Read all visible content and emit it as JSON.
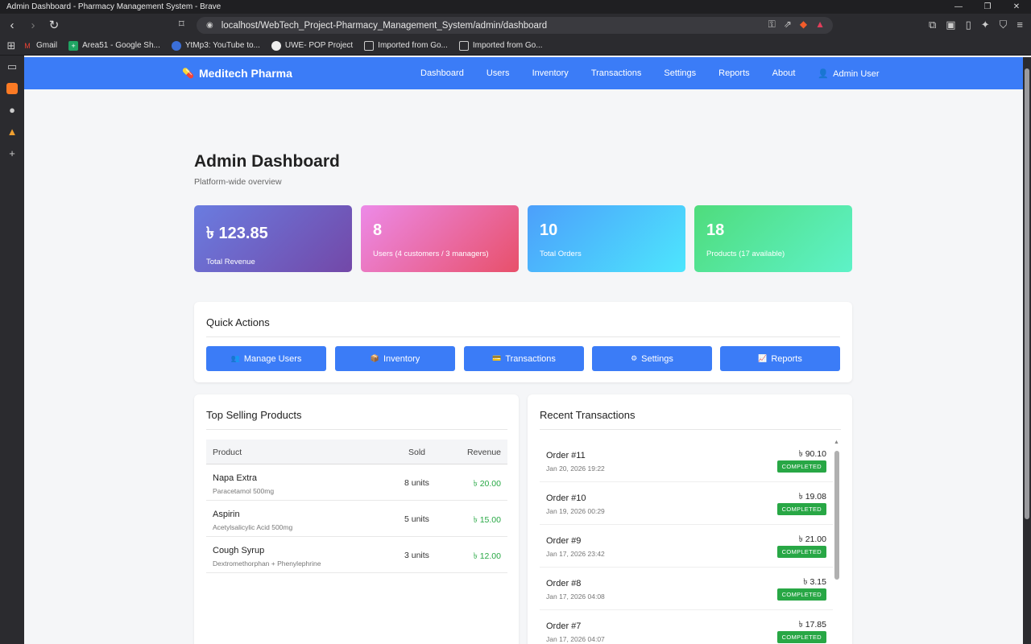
{
  "browser": {
    "window_title": "Admin Dashboard - Pharmacy Management System - Brave",
    "url": "localhost/WebTech_Project-Pharmacy_Management_System/admin/dashboard",
    "bookmarks": [
      {
        "label": "Gmail"
      },
      {
        "label": "Area51 - Google Sh..."
      },
      {
        "label": "YtMp3: YouTube to..."
      },
      {
        "label": "UWE- POP Project"
      },
      {
        "label": "Imported from Go..."
      },
      {
        "label": "Imported from Go..."
      }
    ]
  },
  "app": {
    "brand": "Meditech Pharma",
    "nav": [
      "Dashboard",
      "Users",
      "Inventory",
      "Transactions",
      "Settings",
      "Reports",
      "About"
    ],
    "user": "Admin User",
    "accent": "#3b7cf7"
  },
  "page": {
    "title": "Admin Dashboard",
    "subtitle": "Platform-wide overview"
  },
  "stats": [
    {
      "value": "৳ 123.85",
      "label": "Total Revenue"
    },
    {
      "value": "8",
      "label": "Users (4 customers / 3 managers)"
    },
    {
      "value": "10",
      "label": "Total Orders"
    },
    {
      "value": "18",
      "label": "Products (17 available)"
    }
  ],
  "quick_actions": {
    "title": "Quick Actions",
    "buttons": [
      {
        "label": "Manage Users",
        "icon": "users-icon"
      },
      {
        "label": "Inventory",
        "icon": "package-icon"
      },
      {
        "label": "Transactions",
        "icon": "card-icon"
      },
      {
        "label": "Settings",
        "icon": "gear-icon"
      },
      {
        "label": "Reports",
        "icon": "chart-icon"
      }
    ]
  },
  "top_selling": {
    "title": "Top Selling Products",
    "columns": [
      "Product",
      "Sold",
      "Revenue"
    ],
    "rows": [
      {
        "name": "Napa Extra",
        "desc": "Paracetamol 500mg",
        "sold": "8 units",
        "revenue": "৳ 20.00"
      },
      {
        "name": "Aspirin",
        "desc": "Acetylsalicylic Acid 500mg",
        "sold": "5 units",
        "revenue": "৳ 15.00"
      },
      {
        "name": "Cough Syrup",
        "desc": "Dextromethorphan + Phenylephrine",
        "sold": "3 units",
        "revenue": "৳ 12.00"
      }
    ]
  },
  "recent_transactions": {
    "title": "Recent Transactions",
    "items": [
      {
        "order": "Order #11",
        "date": "Jan 20, 2026 19:22",
        "amount": "৳ 90.10",
        "status": "COMPLETED"
      },
      {
        "order": "Order #10",
        "date": "Jan 19, 2026 00:29",
        "amount": "৳ 19.08",
        "status": "COMPLETED"
      },
      {
        "order": "Order #9",
        "date": "Jan 17, 2026 23:42",
        "amount": "৳ 21.00",
        "status": "COMPLETED"
      },
      {
        "order": "Order #8",
        "date": "Jan 17, 2026 04:08",
        "amount": "৳ 3.15",
        "status": "COMPLETED"
      },
      {
        "order": "Order #7",
        "date": "Jan 17, 2026 04:07",
        "amount": "৳ 17.85",
        "status": "COMPLETED"
      }
    ]
  }
}
